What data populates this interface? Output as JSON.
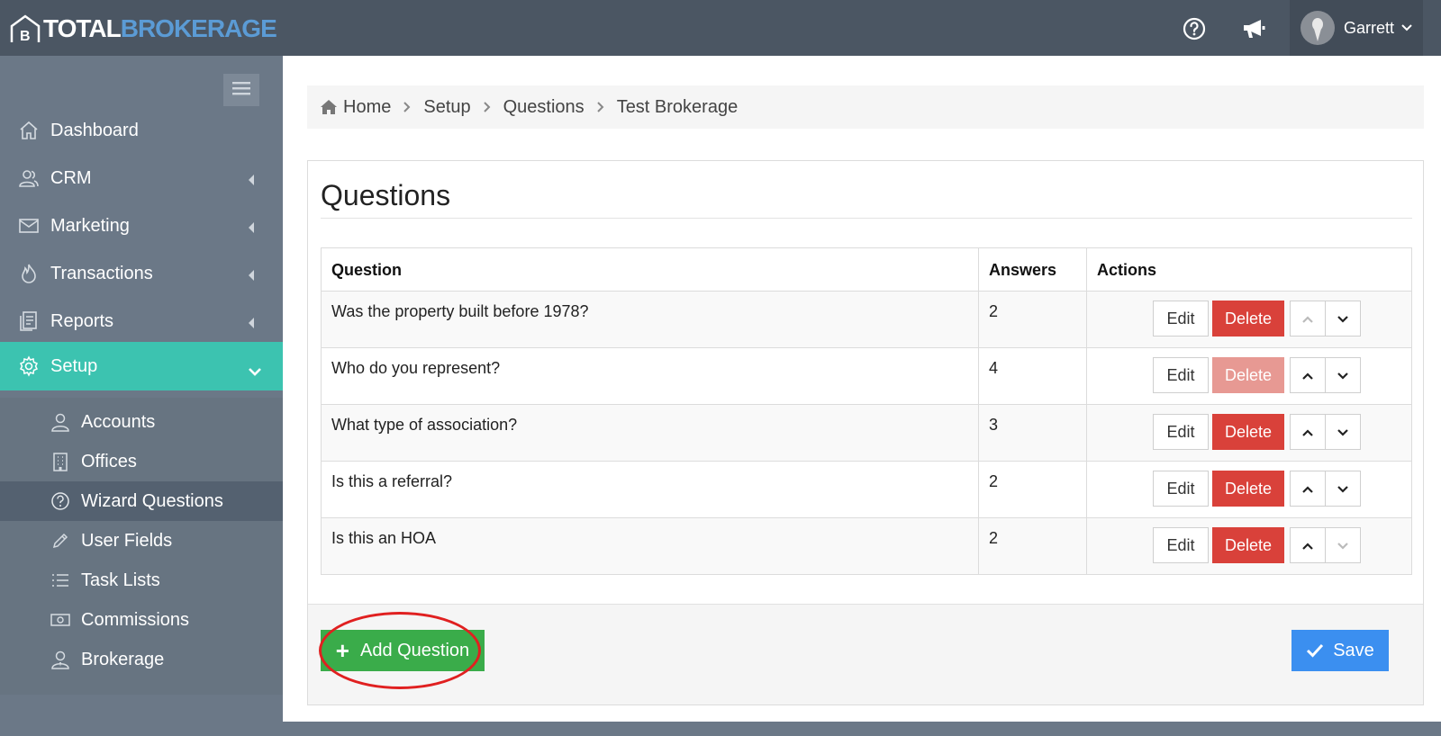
{
  "brand": {
    "part1": "TOTAL",
    "part2": "BROKERAGE",
    "accent": "#5b9bd5"
  },
  "topbar": {
    "help_icon": "question-circle-icon",
    "announce_icon": "megaphone-icon",
    "user_name": "Garrett"
  },
  "sidebar": {
    "items": [
      {
        "label": "Dashboard",
        "icon": "home-icon"
      },
      {
        "label": "CRM",
        "icon": "users-icon"
      },
      {
        "label": "Marketing",
        "icon": "envelope-icon"
      },
      {
        "label": "Transactions",
        "icon": "fire-icon"
      },
      {
        "label": "Reports",
        "icon": "document-icon"
      },
      {
        "label": "Setup",
        "icon": "gear-icon"
      }
    ],
    "sub_items": [
      {
        "label": "Accounts",
        "icon": "user-icon"
      },
      {
        "label": "Offices",
        "icon": "building-icon"
      },
      {
        "label": "Wizard Questions",
        "icon": "question-circle-icon"
      },
      {
        "label": "User Fields",
        "icon": "pencil-icon"
      },
      {
        "label": "Task Lists",
        "icon": "list-icon"
      },
      {
        "label": "Commissions",
        "icon": "money-icon"
      },
      {
        "label": "Brokerage",
        "icon": "user-tie-icon"
      }
    ],
    "active_color": "#3cc3b0"
  },
  "breadcrumb": [
    "Home",
    "Setup",
    "Questions",
    "Test Brokerage"
  ],
  "panel": {
    "title": "Questions",
    "columns": [
      "Question",
      "Answers",
      "Actions"
    ],
    "rows": [
      {
        "question": "Was the property built before 1978?",
        "answers": "2"
      },
      {
        "question": "Who do you represent?",
        "answers": "4"
      },
      {
        "question": "What type of association?",
        "answers": "3"
      },
      {
        "question": "Is this a referral?",
        "answers": "2"
      },
      {
        "question": "Is this an HOA",
        "answers": "2"
      }
    ],
    "edit_label": "Edit",
    "delete_label": "Delete",
    "add_label": "Add Question",
    "save_label": "Save"
  },
  "colors": {
    "delete": "#d9413a",
    "add": "#3aac4a",
    "save": "#3b8ff0"
  }
}
